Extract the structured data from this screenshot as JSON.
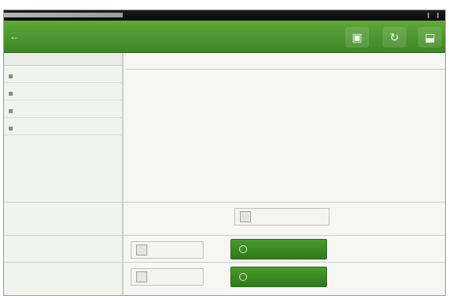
{
  "statusbar": {},
  "appbar": {
    "title": "",
    "back_icon": "←",
    "actions": [
      {
        "icon": "▣",
        "name": "action-1"
      },
      {
        "icon": "↻",
        "name": "action-2"
      },
      {
        "icon": "⬓",
        "name": "action-3"
      }
    ]
  },
  "sidebar": {
    "header": "",
    "items": [
      "",
      "",
      "",
      ""
    ]
  },
  "content": {
    "title": "",
    "body": "",
    "sub": ""
  },
  "dialog": {
    "top_chip": "",
    "left_chip_1": "",
    "left_chip_2": "",
    "primary_button": "",
    "secondary_button": ""
  },
  "colors": {
    "accent": "#4a9a2c",
    "appbar": "#3f8526"
  }
}
